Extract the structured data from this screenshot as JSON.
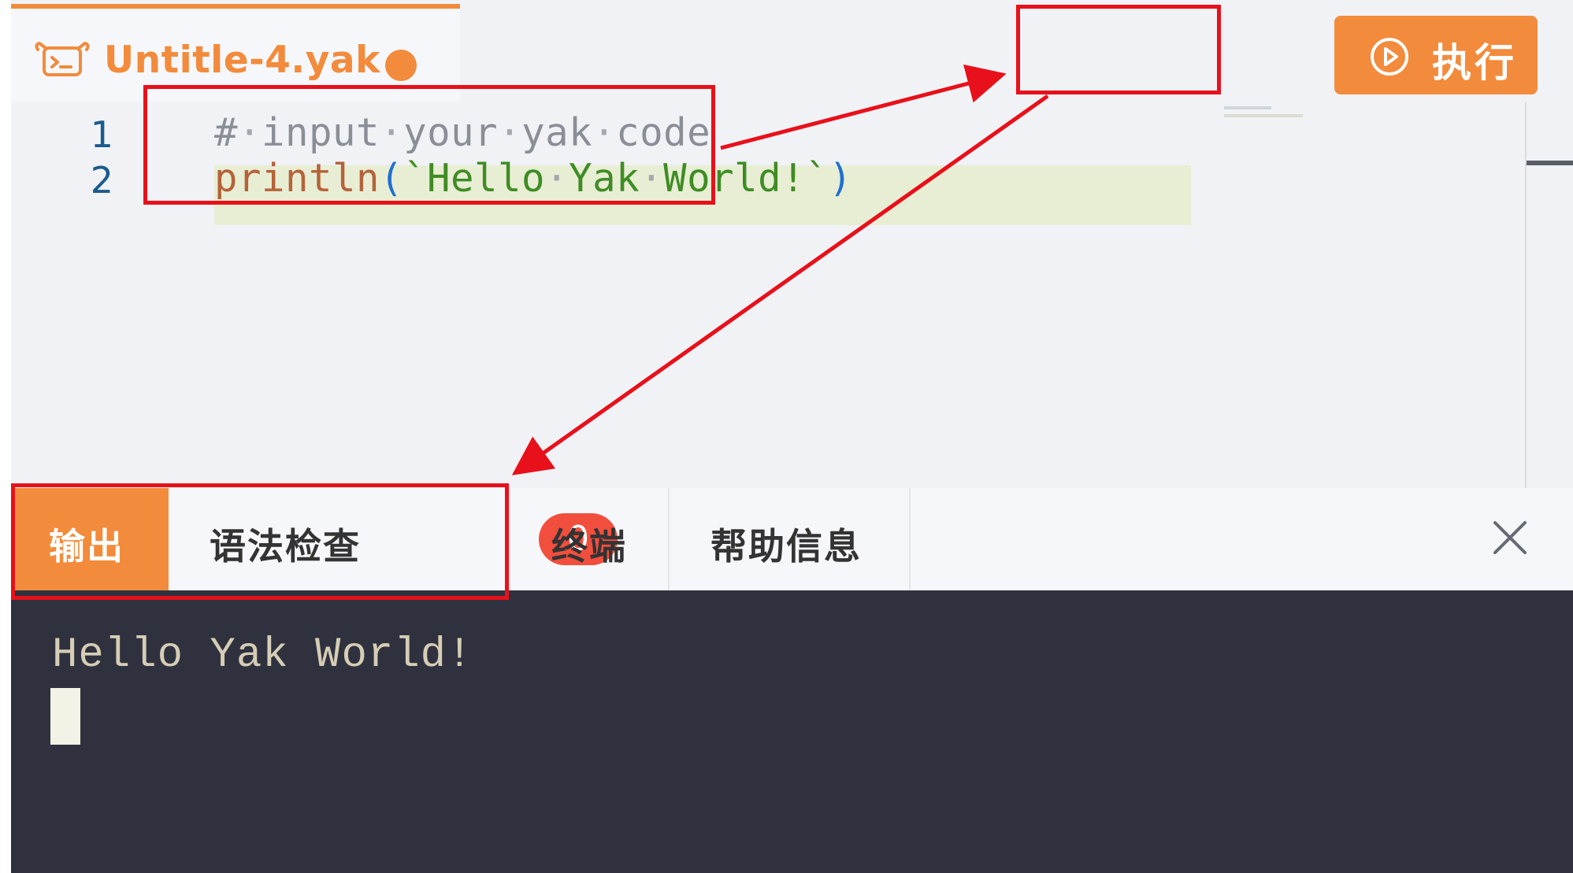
{
  "tab": {
    "title": "Untitle-4.yak"
  },
  "toolbar": {
    "run_label": "执行"
  },
  "editor": {
    "gutter": [
      "1",
      "2"
    ],
    "line1": {
      "t1": "#",
      "t2": "input",
      "t3": "your",
      "t4": "yak",
      "t5": "code",
      "dot": "·"
    },
    "line2": {
      "fn": "println",
      "open": "(",
      "s1": "`Hello",
      "s2": "Yak",
      "s3": "World!`",
      "close": ")",
      "dot": "·"
    }
  },
  "panel": {
    "tabs": [
      {
        "label": "输出",
        "active": true
      },
      {
        "label": "语法检查",
        "badge": "0"
      },
      {
        "label": "终端"
      },
      {
        "label": "帮助信息"
      }
    ]
  },
  "terminal": {
    "output": "Hello Yak World!"
  },
  "colors": {
    "accent": "#f28b3c",
    "annotation": "#e8101a",
    "terminal_bg": "#2f323e",
    "badge": "#f24e3e"
  },
  "icons": [
    "yak-file-icon",
    "play-circle-icon",
    "close-icon"
  ]
}
